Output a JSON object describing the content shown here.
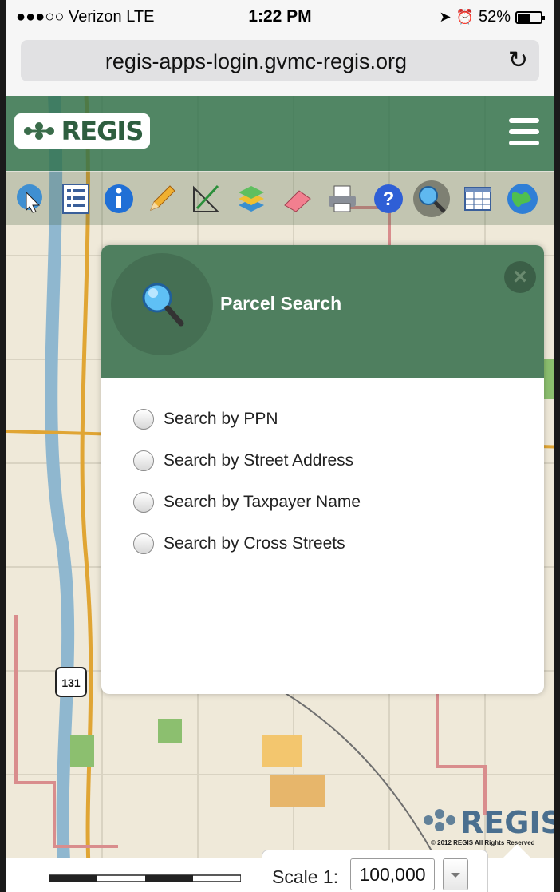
{
  "status": {
    "carrier": "●●●○○ Verizon  LTE",
    "time": "1:22 PM",
    "battery": "52%",
    "battery_level": 0.52
  },
  "browser": {
    "url": "regis-apps-login.gvmc-regis.org"
  },
  "header": {
    "logo_text": "REGIS"
  },
  "toolbar": {
    "tools": [
      "identify-tool",
      "legend-tool",
      "info-tool",
      "draw-tool",
      "measure-tool",
      "layers-tool",
      "eraser-tool",
      "print-tool",
      "help-tool",
      "search-tool",
      "table-tool",
      "globe-tool"
    ]
  },
  "panel": {
    "title": "Parcel Search",
    "options": [
      "Search by PPN",
      "Search by Street Address",
      "Search by Taxpayer Name",
      "Search by Cross Streets"
    ]
  },
  "map": {
    "copyright": "© 2012 REGIS All Rights Reserved",
    "route_label": "131",
    "scale_label": "Scale 1:",
    "scale_value": "100,000"
  },
  "colors": {
    "header": "#2e704a",
    "panel_header": "#4f7f5f",
    "map_bg": "#efe9d9"
  }
}
